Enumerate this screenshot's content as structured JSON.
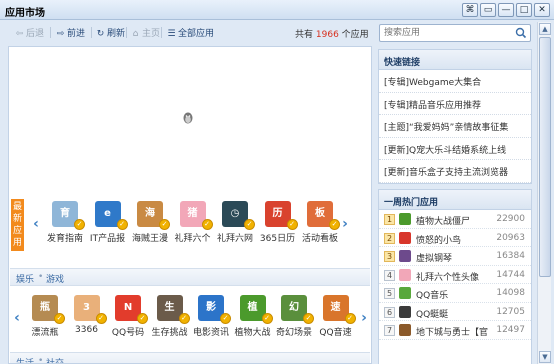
{
  "window": {
    "title": "应用市场",
    "buttons": [
      "⌘",
      "▭",
      "—",
      "□",
      "✕"
    ]
  },
  "toolbar": {
    "back": "后退",
    "forward": "前进",
    "refresh": "刷新",
    "home": "主页",
    "all_apps": "全部应用"
  },
  "total": {
    "prefix": "共有",
    "count": "1966",
    "suffix": "个应用"
  },
  "search": {
    "placeholder": "搜索应用"
  },
  "featured": {
    "badge": "最新应用",
    "apps": [
      {
        "label": "发育指南",
        "icon": "baby-guide-icon",
        "color": "#8fb6d8",
        "glyph": "育"
      },
      {
        "label": "IT产品报",
        "icon": "ie-icon",
        "color": "#2f79c9",
        "glyph": "e"
      },
      {
        "label": "海贼王漫",
        "icon": "one-piece-icon",
        "color": "#c98a43",
        "glyph": "海"
      },
      {
        "label": "礼拜六个",
        "icon": "pig-icon",
        "color": "#f2a7b8",
        "glyph": "猪"
      },
      {
        "label": "礼拜六网",
        "icon": "clock-icon",
        "color": "#2b4a57",
        "glyph": "◷"
      },
      {
        "label": "365日历",
        "icon": "calendar-icon",
        "color": "#d9422e",
        "glyph": "历"
      },
      {
        "label": "活动看板",
        "icon": "board-icon",
        "color": "#e06d3a",
        "glyph": "板"
      }
    ]
  },
  "section1": {
    "a": "娱乐",
    "b": "游戏"
  },
  "games": {
    "apps": [
      {
        "label": "漂流瓶",
        "icon": "bottle-icon",
        "color": "#b58b52",
        "glyph": "瓶"
      },
      {
        "label": "3366",
        "icon": "3366-icon",
        "color": "#e9b07a",
        "glyph": "3"
      },
      {
        "label": "QQ号码",
        "icon": "qq-number-icon",
        "color": "#e23c2c",
        "glyph": "N"
      },
      {
        "label": "生存挑战",
        "icon": "survival-icon",
        "color": "#6b5b4a",
        "glyph": "生"
      },
      {
        "label": "电影资讯",
        "icon": "movie-icon",
        "color": "#2c74c9",
        "glyph": "影"
      },
      {
        "label": "植物大战",
        "icon": "plant-icon",
        "color": "#4b9a2c",
        "glyph": "植"
      },
      {
        "label": "奇幻场景",
        "icon": "fantasy-icon",
        "color": "#5a8f3c",
        "glyph": "幻"
      },
      {
        "label": "QQ音速",
        "icon": "qq-speed-icon",
        "color": "#d9752b",
        "glyph": "速"
      }
    ]
  },
  "section2": {
    "a": "生活",
    "b": "社交"
  },
  "quick_links": {
    "title": "快速链接",
    "items": [
      "[专辑]Webgame大集合",
      "[专辑]精品音乐应用推荐",
      "[主题]“我爱妈妈”亲情故事征集",
      "[更新]Q宠大乐斗结婚系统上线",
      "[更新]音乐盒子支持主流浏览器"
    ]
  },
  "hot": {
    "title": "一周热门应用",
    "items": [
      {
        "rank": "1",
        "name": "植物大战僵尸",
        "count": "22900",
        "color": "#4b9a2c"
      },
      {
        "rank": "2",
        "name": "愤怒的小鸟",
        "count": "20963",
        "color": "#d8362b"
      },
      {
        "rank": "3",
        "name": "虚拟钢琴",
        "count": "16384",
        "color": "#6d4a8c"
      },
      {
        "rank": "4",
        "name": "礼拜六个性头像",
        "count": "14744",
        "color": "#f2a7b8"
      },
      {
        "rank": "5",
        "name": "QQ音乐",
        "count": "14098",
        "color": "#59a83c"
      },
      {
        "rank": "6",
        "name": "QQ蜓蜓",
        "count": "12705",
        "color": "#3b3b3b"
      },
      {
        "rank": "7",
        "name": "地下城与勇士【官",
        "count": "12497",
        "color": "#8b5a2b"
      }
    ]
  }
}
